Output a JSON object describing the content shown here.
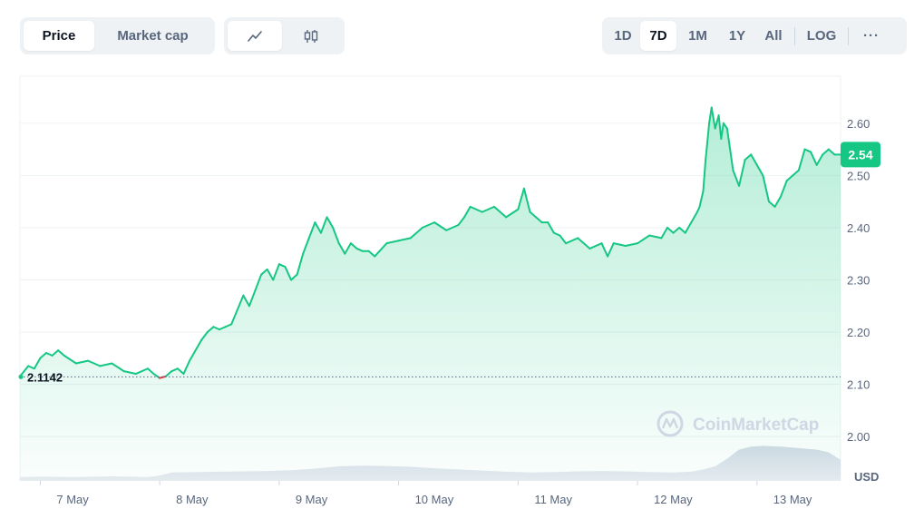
{
  "toolbar": {
    "price_label": "Price",
    "marketcap_label": "Market cap",
    "line_chart_icon": "line-chart-icon",
    "candle_chart_icon": "candlestick-icon",
    "ranges": [
      "1D",
      "7D",
      "1M",
      "1Y",
      "All"
    ],
    "active_range": "7D",
    "log_label": "LOG",
    "more_label": "···"
  },
  "watermark": {
    "text": "CoinMarketCap"
  },
  "colors": {
    "up": "#16c784",
    "down": "#ea3943",
    "grid": "#eff2f5",
    "volume": "#cfd6e4"
  },
  "chart_data": {
    "type": "line",
    "currency_label": "USD",
    "y_ticks": [
      "2.00",
      "2.10",
      "2.20",
      "2.30",
      "2.40",
      "2.50",
      "2.60"
    ],
    "ylim": [
      1.915,
      2.69
    ],
    "x_ticks": [
      "7 May",
      "8 May",
      "9 May",
      "10 May",
      "11 May",
      "12 May",
      "13 May"
    ],
    "xlim": [
      6.83,
      13.7
    ],
    "open_price": 2.1142,
    "open_price_label": "2.1142",
    "current_price_label": "2.54",
    "current_price": 2.54,
    "series": [
      {
        "x": [
          6.83,
          6.9,
          6.95,
          7.0,
          7.05,
          7.1,
          7.15,
          7.2,
          7.3,
          7.4,
          7.5,
          7.6,
          7.7,
          7.8,
          7.9,
          7.95,
          8.0,
          8.05,
          8.1,
          8.15,
          8.2,
          8.25,
          8.3,
          8.35,
          8.4,
          8.45,
          8.5,
          8.55,
          8.6,
          8.7,
          8.75,
          8.8,
          8.85,
          8.9,
          8.95,
          9.0,
          9.05,
          9.1,
          9.15,
          9.2,
          9.25,
          9.3,
          9.35,
          9.4,
          9.45,
          9.5,
          9.55,
          9.6,
          9.65,
          9.7,
          9.75,
          9.8,
          9.9,
          10.0,
          10.1,
          10.2,
          10.3,
          10.4,
          10.5,
          10.55,
          10.6,
          10.7,
          10.8,
          10.9,
          11.0,
          11.05,
          11.1,
          11.15,
          11.2,
          11.25,
          11.3,
          11.35,
          11.4,
          11.5,
          11.6,
          11.7,
          11.75,
          11.8,
          11.9,
          12.0,
          12.1,
          12.2,
          12.25,
          12.3,
          12.35,
          12.4,
          12.45,
          12.5,
          12.52,
          12.55,
          12.57,
          12.6,
          12.62,
          12.65,
          12.68,
          12.7,
          12.72,
          12.75,
          12.8,
          12.85,
          12.9,
          12.95,
          13.0,
          13.05,
          13.08,
          13.1,
          13.15,
          13.2,
          13.25,
          13.3,
          13.35,
          13.4,
          13.45,
          13.5,
          13.55,
          13.6,
          13.65,
          13.7
        ],
        "values": [
          2.115,
          2.135,
          2.13,
          2.15,
          2.16,
          2.155,
          2.165,
          2.155,
          2.14,
          2.145,
          2.135,
          2.14,
          2.125,
          2.12,
          2.13,
          2.12,
          2.112,
          2.115,
          2.125,
          2.13,
          2.12,
          2.145,
          2.165,
          2.185,
          2.2,
          2.21,
          2.205,
          2.21,
          2.215,
          2.27,
          2.25,
          2.28,
          2.31,
          2.32,
          2.3,
          2.33,
          2.325,
          2.3,
          2.31,
          2.35,
          2.38,
          2.41,
          2.39,
          2.42,
          2.4,
          2.37,
          2.35,
          2.37,
          2.36,
          2.355,
          2.355,
          2.345,
          2.37,
          2.375,
          2.38,
          2.4,
          2.41,
          2.395,
          2.405,
          2.42,
          2.44,
          2.43,
          2.44,
          2.42,
          2.435,
          2.475,
          2.43,
          2.42,
          2.41,
          2.41,
          2.39,
          2.385,
          2.37,
          2.38,
          2.36,
          2.37,
          2.345,
          2.37,
          2.365,
          2.37,
          2.385,
          2.38,
          2.4,
          2.39,
          2.4,
          2.39,
          2.41,
          2.43,
          2.44,
          2.47,
          2.53,
          2.6,
          2.63,
          2.59,
          2.615,
          2.57,
          2.6,
          2.59,
          2.51,
          2.48,
          2.53,
          2.54,
          2.52,
          2.5,
          2.47,
          2.45,
          2.44,
          2.46,
          2.49,
          2.5,
          2.51,
          2.55,
          2.545,
          2.52,
          2.54,
          2.55,
          2.54,
          2.54
        ]
      }
    ],
    "volume": {
      "x": [
        6.83,
        7.0,
        7.3,
        7.6,
        7.9,
        8.0,
        8.1,
        8.3,
        8.5,
        8.7,
        8.9,
        9.1,
        9.3,
        9.5,
        9.7,
        9.9,
        10.1,
        10.3,
        10.5,
        10.7,
        10.9,
        11.1,
        11.3,
        11.5,
        11.7,
        11.9,
        12.1,
        12.3,
        12.45,
        12.55,
        12.65,
        12.75,
        12.85,
        12.95,
        13.05,
        13.2,
        13.35,
        13.5,
        13.6,
        13.7
      ],
      "values": [
        0.1,
        0.11,
        0.1,
        0.12,
        0.1,
        0.14,
        0.22,
        0.23,
        0.24,
        0.25,
        0.26,
        0.28,
        0.32,
        0.38,
        0.4,
        0.39,
        0.37,
        0.33,
        0.3,
        0.27,
        0.24,
        0.22,
        0.23,
        0.25,
        0.26,
        0.25,
        0.23,
        0.22,
        0.24,
        0.3,
        0.38,
        0.58,
        0.82,
        0.9,
        0.92,
        0.9,
        0.86,
        0.82,
        0.75,
        0.55
      ]
    }
  }
}
